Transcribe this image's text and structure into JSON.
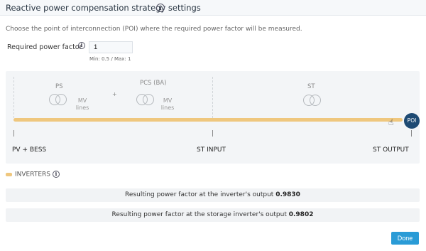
{
  "header": {
    "title": "Reactive power compensation strategy settings",
    "info_icon": "info-icon"
  },
  "description": "Choose the point of interconnection (POI) where the required power factor will be measured.",
  "power_factor": {
    "label": "Required power factor",
    "value": "1",
    "hint": "Min: 0.5 / Max: 1"
  },
  "diagram": {
    "segments": [
      {
        "label": "PS",
        "lines_label": "MV\nlines"
      },
      {
        "label": "PCS (BA)",
        "lines_label": "MV\nlines"
      },
      {
        "label": "ST"
      }
    ],
    "plus": "+",
    "points": [
      "PV + BESS",
      "ST INPUT",
      "ST OUTPUT"
    ],
    "poi_label": "POI",
    "bus_color": "#efc77e"
  },
  "legend": {
    "label": "INVERTERS"
  },
  "results": {
    "inverter_text": "Resulting power factor at the inverter's output",
    "inverter_value": "0.9830",
    "storage_text": "Resulting power factor at the storage inverter's output",
    "storage_value": "0.9802"
  },
  "done_label": "Done",
  "colors": {
    "accent": "#2a9bd6",
    "poi": "#1e4a73",
    "bus": "#efc77e"
  }
}
